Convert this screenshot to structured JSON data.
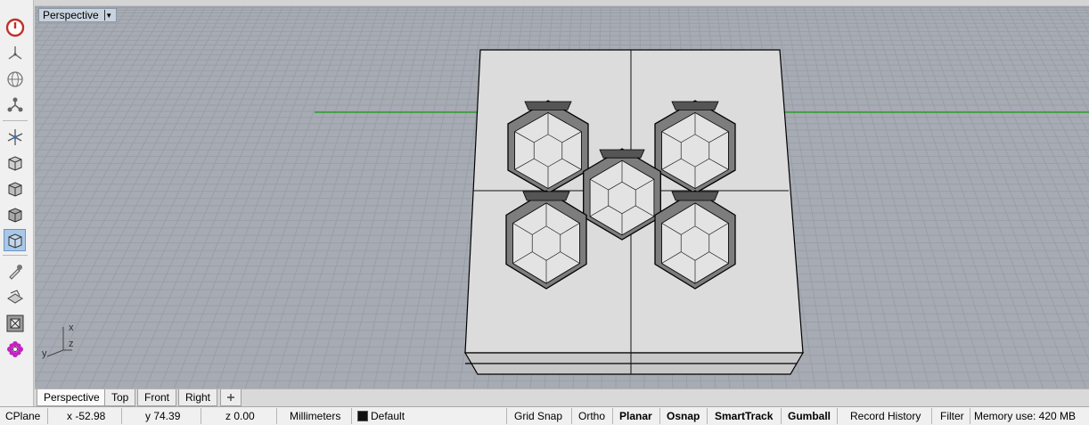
{
  "viewport": {
    "title": "Perspective",
    "axes": {
      "x": "x",
      "y": "y",
      "z": "z"
    }
  },
  "toolbar": {
    "icons": [
      "power-icon",
      "cplane-icon",
      "world-icon",
      "gumball-icon",
      "transform-icon",
      "box-icon",
      "box-icon",
      "box-icon",
      "box-selected-icon",
      "pipette-icon",
      "layer-icon",
      "frame-icon",
      "flower-icon"
    ]
  },
  "tabs": [
    "Perspective",
    "Top",
    "Front",
    "Right"
  ],
  "status": {
    "cplane": "CPlane",
    "x": "x -52.98",
    "y": "y 74.39",
    "z": "z 0.00",
    "units": "Millimeters",
    "layer": "Default",
    "grid_snap": "Grid Snap",
    "ortho": "Ortho",
    "planar": "Planar",
    "osnap": "Osnap",
    "smarttrack": "SmartTrack",
    "gumball": "Gumball",
    "record_history": "Record History",
    "filter": "Filter",
    "memory": "Memory use: 420 MB"
  },
  "colors": {
    "viewport_bg": "#a7abb3",
    "grid": "#9a9ea6",
    "x_axis": "#2c9e2c",
    "y_axis": "#9e2c2c",
    "model_face": "#dcdcdc",
    "edges": "#000000"
  }
}
